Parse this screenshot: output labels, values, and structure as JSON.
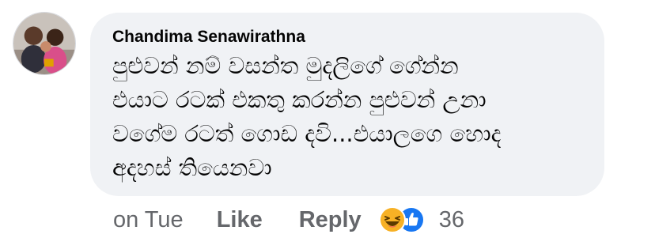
{
  "comment": {
    "author": "Chandima Senawirathna",
    "text": "පුළුවන් නම් වසන්ත මුදලිගේ ගේන්න\nඑයාට රටක් එකතු කරන්න පුළුවන් උනා\nවගේම රටත් ගොඩ දවි...එයාලගෙ හොද\nඅදහස් තියෙනවා",
    "timestamp": "on Tue",
    "like_label": "Like",
    "reply_label": "Reply",
    "reaction_count": "36",
    "reactions": [
      "haha-icon",
      "like-icon"
    ]
  },
  "colors": {
    "bubble": "#f0f2f5",
    "meta_text": "#65676b",
    "body_text": "#050505",
    "like_blue": "#1877f2",
    "haha_yellow": "#f7b125"
  }
}
